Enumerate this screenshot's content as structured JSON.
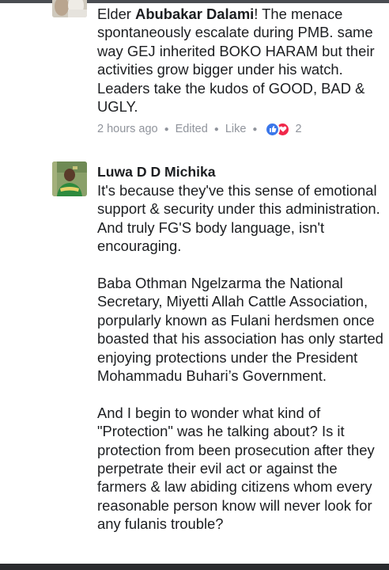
{
  "comments": [
    {
      "author_prefix": "Elder ",
      "author_mention": "Abubakar Dalami",
      "text_after_mention": "! The menace spontaneously escalate during PMB. same way GEJ inherited BOKO HARAM but their activities grow bigger under his watch. Leaders take the kudos of GOOD, BAD & UGLY.",
      "meta": {
        "time": "2 hours ago",
        "edited": "Edited",
        "like": "Like",
        "reaction_count": "2"
      }
    },
    {
      "name": "Luwa D D Michika",
      "paragraphs": [
        "It's because they've this sense of emotional support & security under this administration. And truly FG'S body language, isn't encouraging.",
        "Baba Othman Ngelzarma the National Secretary, Miyetti Allah Cattle Association, porpularly known as Fulani herdsmen once boasted that his association has only started enjoying protections under the President Mohammadu Buhari’s Government.",
        "And I begin to wonder what kind of \"Protection\" was he talking about? Is it protection from been prosecution after they perpetrate their evil act or against the farmers & law abiding citizens whom every reasonable person know will never look for any fulanis trouble?"
      ]
    }
  ],
  "colors": {
    "text": "#1c1e21",
    "meta": "#90949c",
    "like_reaction": "#3b77ea",
    "love_reaction": "#f0284a"
  },
  "icons": {
    "like": "thumbs-up-icon",
    "love": "heart-icon"
  }
}
